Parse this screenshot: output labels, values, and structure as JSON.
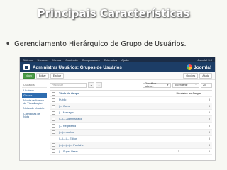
{
  "slide": {
    "title": "Principais Características",
    "bullet": "Gerenciamento Hierárquico de Grupo de Usuários."
  },
  "admin": {
    "topmenu": [
      "Sistema",
      "Usuários",
      "Menus",
      "Conteúdo",
      "Componentes",
      "Extensões",
      "Ajuda"
    ],
    "topmenu_right": "Joomla! 3.0",
    "header_title": "Administrar Usuários: Grupos de Usuários",
    "brand": "Joomla!",
    "toolbar": {
      "new": "Novo",
      "edit": "Editar",
      "delete": "Excluir",
      "options": "Opções",
      "help": "Ajuda"
    },
    "sidebar": {
      "heading": "Usuários",
      "items": [
        {
          "label": "Usuários",
          "active": false
        },
        {
          "label": "Grupos",
          "active": true
        },
        {
          "label": "Níveis de Acesso de Visualização",
          "active": false
        },
        {
          "label": "Notas de Usuário",
          "active": false
        },
        {
          "label": "Categorias de Nota",
          "active": false
        }
      ]
    },
    "filters": {
      "search_placeholder": "Pesquisar",
      "search_icon": "search-icon",
      "clear_icon": "close-icon",
      "sort_field": "Classificar tabela...",
      "sort_order": "Ascendente",
      "limit": "20"
    },
    "table": {
      "col_title": "Título do Grupo",
      "col_users": "Usuários no Grupo",
      "rows": [
        {
          "title": "Public",
          "active": "",
          "enabled": "",
          "id": "0"
        },
        {
          "title": "|— Guest",
          "active": "",
          "enabled": "",
          "id": "0"
        },
        {
          "title": "|— Manager",
          "active": "",
          "enabled": "",
          "id": "0"
        },
        {
          "title": "|—|— Administrator",
          "active": "",
          "enabled": "",
          "id": "0"
        },
        {
          "title": "|— Registered",
          "active": "",
          "enabled": "",
          "id": "0"
        },
        {
          "title": "|—|— Author",
          "active": "",
          "enabled": "",
          "id": "0"
        },
        {
          "title": "|—|—|— Editor",
          "active": "",
          "enabled": "",
          "id": "0"
        },
        {
          "title": "|—|—|—|— Publisher",
          "active": "",
          "enabled": "",
          "id": "0"
        },
        {
          "title": "|— Super Users",
          "active": "1",
          "enabled": "",
          "id": "0"
        }
      ]
    }
  }
}
